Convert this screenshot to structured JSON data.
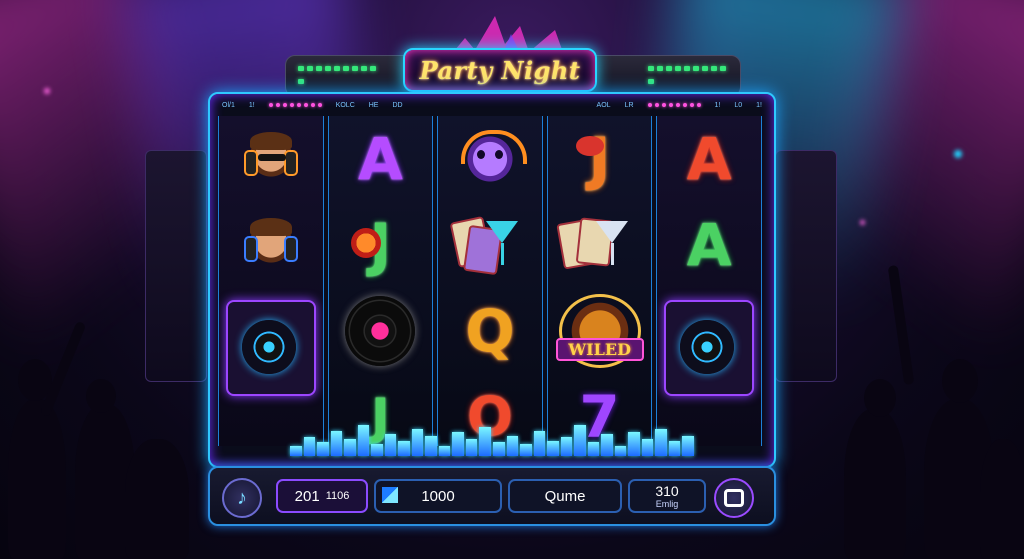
{
  "game": {
    "title": "Party Night"
  },
  "status_bar": {
    "items": [
      "Ol/1",
      "1!",
      "KOLC",
      "HE",
      "DD",
      "AOL",
      "LR",
      "1!",
      "L0",
      "1!"
    ]
  },
  "reels": [
    [
      "dj-sunglasses",
      "dj-headphones",
      "speaker"
    ],
    [
      "A",
      "J",
      "vinyl-record",
      "J"
    ],
    [
      "skull-headphones",
      "cards-cocktail",
      "Q",
      "O"
    ],
    [
      "J",
      "cards-cocktail-2",
      "wild",
      "7"
    ],
    [
      "A",
      "A",
      "speaker"
    ]
  ],
  "symbols": {
    "wild_label": "WILED"
  },
  "controls": {
    "left_icon": "music-note-icon",
    "credit_main": "201",
    "credit_sub": "1106",
    "bet_value": "1000",
    "center_label": "Qume",
    "win_value": "310",
    "win_label": "Emlig",
    "right_icon": "square-icon"
  },
  "colors": {
    "accent_cyan": "#2fc8ff",
    "accent_magenta": "#ff36c6",
    "title_gold": "#ffe46b"
  }
}
